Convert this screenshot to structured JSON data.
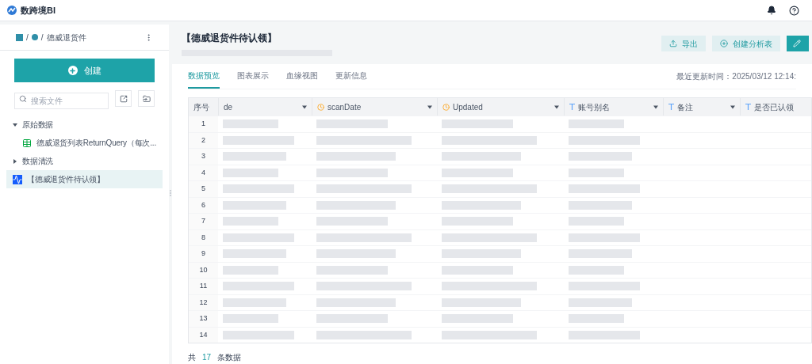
{
  "app": {
    "logo_text": "数跨境BI"
  },
  "breadcrumb": {
    "separator": "/",
    "items": [
      "德威退货件"
    ]
  },
  "sidebar": {
    "create_button": "创建",
    "search": {
      "placeholder": "搜索文件"
    },
    "tree": [
      {
        "label": "原始数据",
        "kind": "folder",
        "expanded": true,
        "selected": false,
        "children": [
          {
            "label": "德威退货列表ReturnQuery（每次...",
            "kind": "table",
            "selected": false
          }
        ]
      },
      {
        "label": "数据清洗",
        "kind": "folder",
        "expanded": false,
        "selected": false
      },
      {
        "label": "【德威退货件待认领】",
        "kind": "chart",
        "selected": true
      }
    ]
  },
  "main": {
    "title": "【德威退货件待认领】",
    "actions": [
      {
        "label": "导出",
        "kind": "export"
      },
      {
        "label": "创建分析表",
        "kind": "create"
      },
      {
        "kind": "edit"
      }
    ],
    "tabs": [
      {
        "label": "数据预览",
        "selected": true
      },
      {
        "label": "图表展示",
        "selected": false
      },
      {
        "label": "血缘视图",
        "selected": false
      },
      {
        "label": "更新信息",
        "selected": false
      }
    ],
    "last_updated": "最近更新时间：2025/03/12 12:14:",
    "table": {
      "index_header": "序号",
      "columns": [
        {
          "label": "de",
          "kind": "plain"
        },
        {
          "label": "scanDate",
          "kind": "date"
        },
        {
          "label": "Updated",
          "kind": "date"
        },
        {
          "label": "账号别名",
          "kind": "text"
        },
        {
          "label": "备注",
          "kind": "text"
        },
        {
          "label": "是否已认领",
          "kind": "text"
        }
      ],
      "rows": [
        "1",
        "2",
        "3",
        "4",
        "5",
        "6",
        "7",
        "8",
        "9",
        "10",
        "11",
        "12",
        "13",
        "14"
      ]
    },
    "footer": {
      "prefix": "共",
      "count": "17",
      "suffix": "条数据"
    }
  }
}
